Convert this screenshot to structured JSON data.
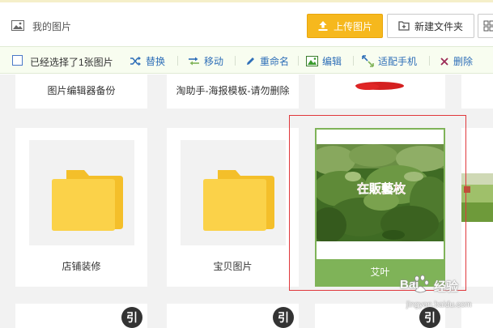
{
  "header": {
    "title": "我的图片",
    "upload_label": "上传图片",
    "new_folder_label": "新建文件夹"
  },
  "toolbar": {
    "selected_text": "已经选择了1张图片",
    "actions": [
      {
        "label": "替换",
        "icon": "shuffle-icon"
      },
      {
        "label": "移动",
        "icon": "move-arrows-icon"
      },
      {
        "label": "重命名",
        "icon": "pencil-icon"
      },
      {
        "label": "编辑",
        "icon": "image-edit-icon"
      },
      {
        "label": "适配手机",
        "icon": "fit-mobile-icon"
      },
      {
        "label": "删除",
        "icon": "close-icon"
      }
    ]
  },
  "grid": {
    "top_row": [
      "图片编辑器备份",
      "淘助手-海报模板-请勿删除"
    ],
    "folders": [
      "店铺装修",
      "宝贝图片"
    ],
    "selected_image": {
      "caption": "艾叶",
      "overlay_text": "在販藝枚"
    },
    "quote_badge": "引"
  },
  "watermark": {
    "brand": "Bai",
    "brand2": "经验",
    "url": "jingyan.baidu.com"
  },
  "colors": {
    "accent_yellow": "#f6b81d",
    "selection_green": "#7fb358",
    "highlight_red": "#e0383c",
    "folder_yellow": "#f9d04a",
    "toolbar_link": "#2f6fb8"
  }
}
